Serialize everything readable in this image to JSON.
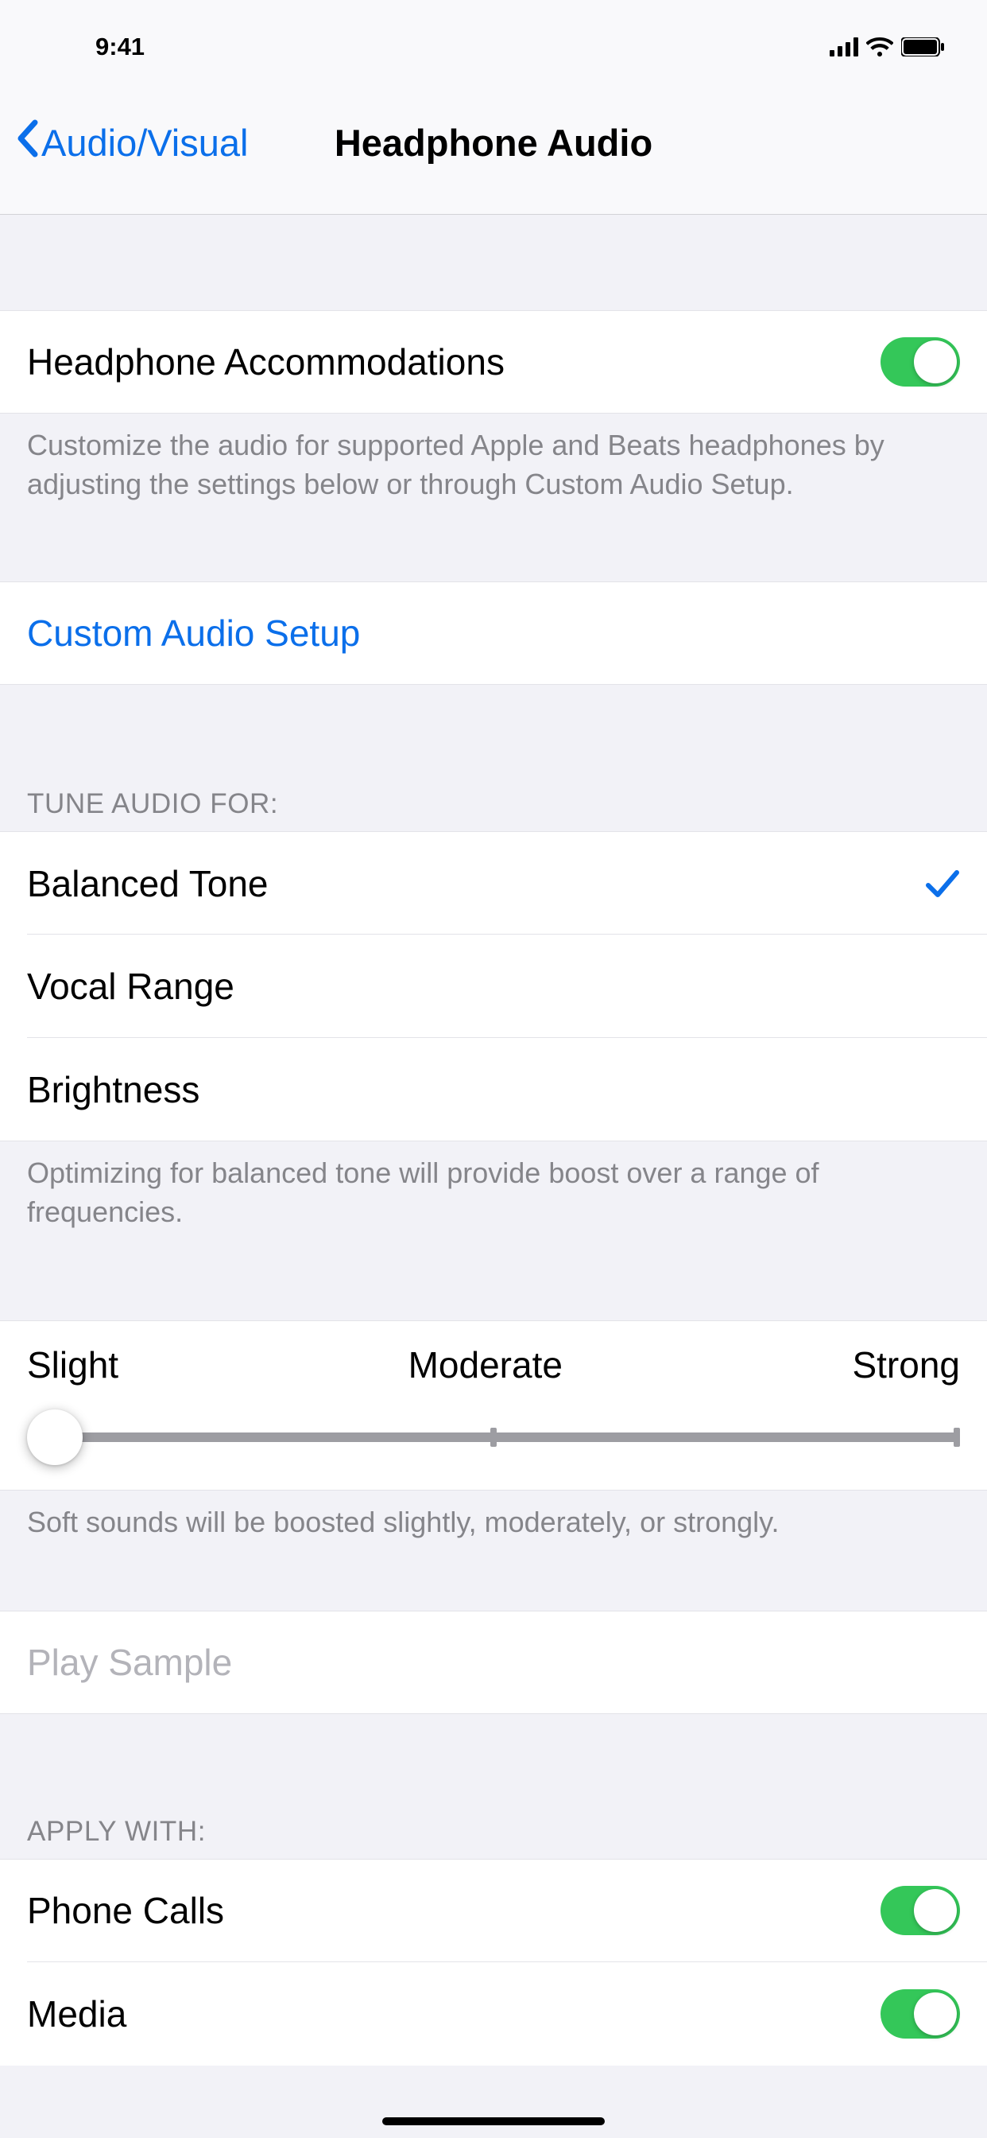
{
  "status": {
    "time": "9:41"
  },
  "nav": {
    "back_label": "Audio/Visual",
    "title": "Headphone Audio"
  },
  "accommodations": {
    "label": "Headphone Accommodations",
    "enabled": true,
    "footer": "Customize the audio for supported Apple and Beats headphones by adjusting the settings below or through Custom Audio Setup."
  },
  "custom_setup": {
    "label": "Custom Audio Setup"
  },
  "tune": {
    "header": "TUNE AUDIO FOR:",
    "options": [
      {
        "label": "Balanced Tone",
        "selected": true
      },
      {
        "label": "Vocal Range",
        "selected": false
      },
      {
        "label": "Brightness",
        "selected": false
      }
    ],
    "footer": "Optimizing for balanced tone will provide boost over a range of frequencies."
  },
  "boost": {
    "labels": [
      "Slight",
      "Moderate",
      "Strong"
    ],
    "value": 0,
    "footer": "Soft sounds will be boosted slightly, moderately, or strongly."
  },
  "play_sample": {
    "label": "Play Sample",
    "enabled": false
  },
  "apply": {
    "header": "APPLY WITH:",
    "items": [
      {
        "label": "Phone Calls",
        "enabled": true
      },
      {
        "label": "Media",
        "enabled": true
      }
    ]
  }
}
